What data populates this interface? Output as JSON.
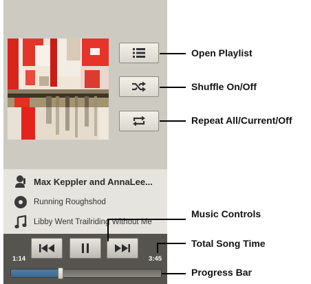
{
  "player": {
    "artist": "Max Keppler and AnnaLee...",
    "album": "Running Roughshod",
    "song": "Libby Went Trailriding Without  Me",
    "elapsed": "1:14",
    "total": "3:45",
    "progress_fraction": 0.33
  },
  "icons": {
    "playlist": "playlist-icon",
    "shuffle": "shuffle-icon",
    "repeat": "repeat-icon",
    "artist": "microphone-icon",
    "album": "disc-icon",
    "song": "music-note-icon",
    "prev": "previous-icon",
    "pause": "pause-icon",
    "next": "next-icon"
  },
  "callouts": {
    "open_playlist": "Open Playlist",
    "shuffle": "Shuffle On/Off",
    "repeat": "Repeat All/Current/Off",
    "music_controls": "Music Controls",
    "total_song_time": "Total Song Time",
    "progress_bar": "Progress Bar"
  },
  "colors": {
    "screen_bg": "#cdcac1",
    "info_bg": "#e6e4de",
    "controls_bg": "#56544f",
    "progress_fill": "#3a6a8f",
    "callout_line": "#000000"
  }
}
